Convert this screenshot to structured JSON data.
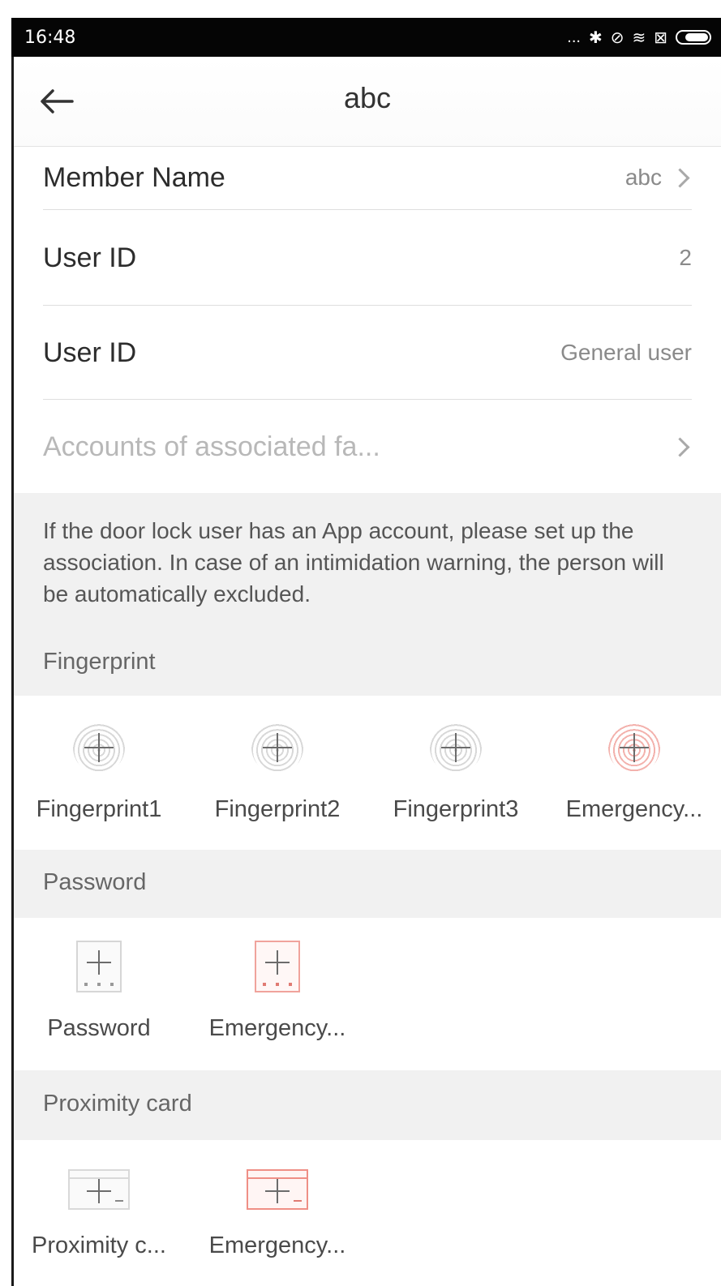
{
  "status_bar": {
    "time": "16:48",
    "more": "...",
    "bluetooth": "✱",
    "signal": "⊘",
    "wifi": "≋",
    "sim": "⊠"
  },
  "header": {
    "title": "abc"
  },
  "rows": [
    {
      "label": "Member Name",
      "value": "abc"
    },
    {
      "label": "User ID",
      "value": "2"
    },
    {
      "label": "User ID",
      "value": "General user"
    },
    {
      "label": "Accounts of associated fa..."
    }
  ],
  "note": "If the door lock user has an App account, please set up the association. In case of an intimidation warning, the person will be automatically excluded.",
  "fingerprint": {
    "label": "Fingerprint",
    "items": [
      "Fingerprint1",
      "Fingerprint2",
      "Fingerprint3",
      "Emergency..."
    ]
  },
  "password": {
    "label": "Password",
    "items": [
      "Password",
      "Emergency..."
    ]
  },
  "proximity": {
    "label": "Proximity card",
    "items": [
      "Proximity c...",
      "Emergency..."
    ]
  },
  "colors": {
    "accent_red": "#ef8f86",
    "band_gray": "#f1f1f1"
  }
}
